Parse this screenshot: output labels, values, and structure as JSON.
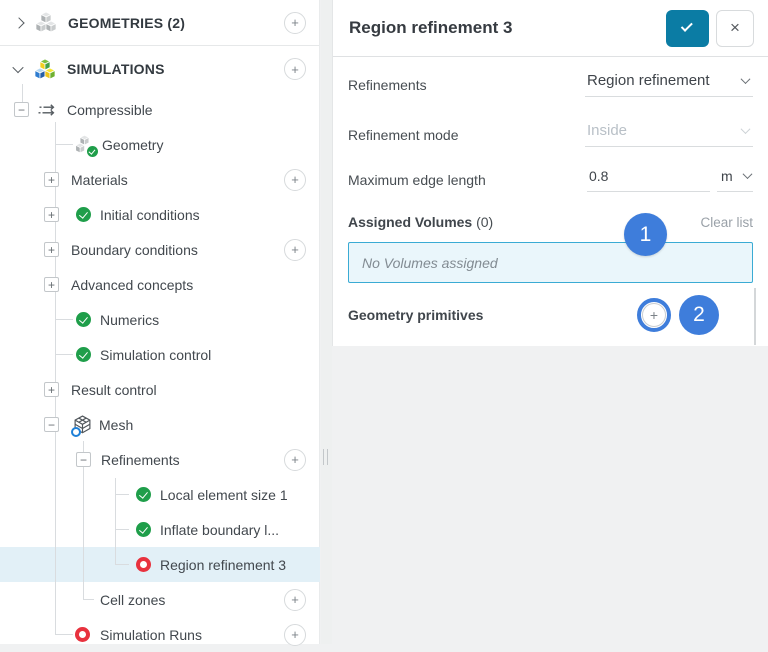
{
  "glyphs": {
    "plus": "+",
    "minus": "−",
    "close": "×"
  },
  "sidebar": {
    "sections": [
      {
        "label": "GEOMETRIES (2)",
        "icon": "cubes-grey-icon"
      },
      {
        "label": "SIMULATIONS",
        "icon": "cubes-color-icon"
      }
    ],
    "items": [
      {
        "label": "Compressible",
        "icon": "flow-arrows-icon"
      },
      {
        "label": "Geometry",
        "icon": "geometry-cubes-icon",
        "status": "done"
      },
      {
        "label": "Materials"
      },
      {
        "label": "Initial conditions",
        "status": "done"
      },
      {
        "label": "Boundary conditions"
      },
      {
        "label": "Advanced concepts"
      },
      {
        "label": "Numerics",
        "status": "done"
      },
      {
        "label": "Simulation control",
        "status": "done"
      },
      {
        "label": "Result control"
      },
      {
        "label": "Mesh",
        "icon": "mesh-cube-icon"
      },
      {
        "label": "Refinements"
      },
      {
        "label": "Local element size 1",
        "status": "done"
      },
      {
        "label": "Inflate boundary l...",
        "status": "done"
      },
      {
        "label": "Region refinement 3",
        "status": "error",
        "selected": true
      },
      {
        "label": "Cell zones"
      },
      {
        "label": "Simulation Runs",
        "status": "error"
      }
    ]
  },
  "panel": {
    "title": "Region refinement 3",
    "fields": {
      "refinements": {
        "label": "Refinements",
        "value": "Region refinement"
      },
      "refinement_mode": {
        "label": "Refinement mode",
        "value": "Inside",
        "disabled": true
      },
      "max_edge": {
        "label": "Maximum edge length",
        "value": "0.8",
        "unit": "m"
      }
    },
    "assigned_volumes": {
      "label": "Assigned Volumes",
      "count": "(0)",
      "clear_label": "Clear list",
      "empty_message": "No Volumes assigned"
    },
    "geometry_primitives": {
      "label": "Geometry primitives"
    },
    "annotations": {
      "step1": "1",
      "step2": "2"
    }
  },
  "colors": {
    "accent_teal": "#0b7ca4",
    "annotation_blue": "#3e7ddb",
    "success_green": "#1f9e4a",
    "error_red": "#e8323e",
    "selected_row": "#e2f0f7",
    "info_bg": "#eaf6fb",
    "info_border": "#3aabd4"
  }
}
